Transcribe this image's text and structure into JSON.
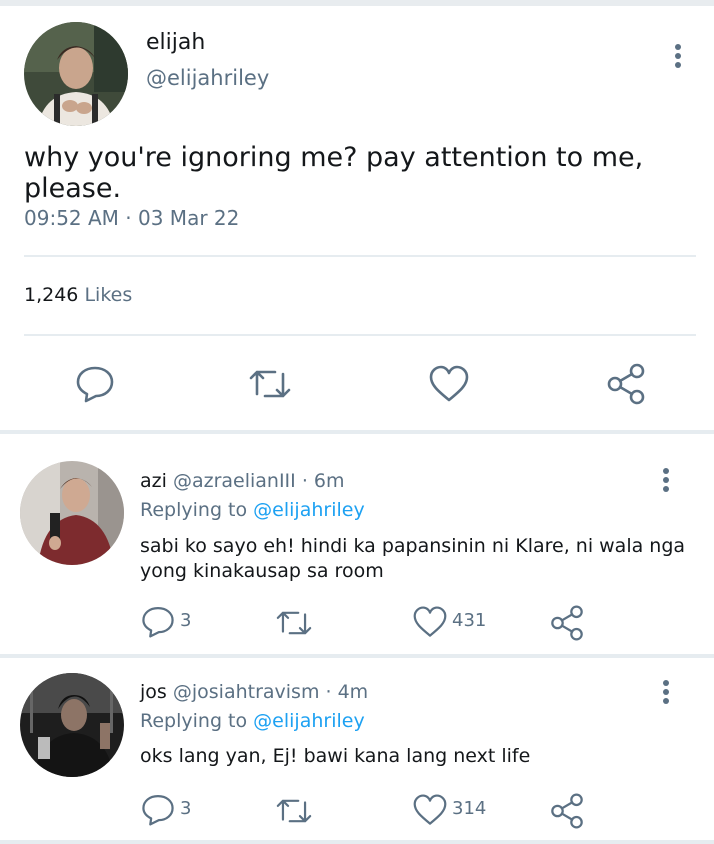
{
  "main_tweet": {
    "display_name": "elijah",
    "handle": "@elijahriley",
    "text": "why you're ignoring me? pay attention to me, please.",
    "timestamp": "09:52 AM · 03 Mar 22",
    "likes_count": "1,246",
    "likes_label": "Likes"
  },
  "replies": [
    {
      "display_name": "azi",
      "handle": "@azraelianIII",
      "time": "· 6m",
      "replying_label": "Replying to",
      "replying_handle": "@elijahriley",
      "text_line1": "sabi ko sayo eh! hindi ka papansinin ni Klare, ni wala nga",
      "text_line2": "yong kinakausap sa room",
      "reply_count": "3",
      "like_count": "431"
    },
    {
      "display_name": "jos",
      "handle": "@josiahtravism",
      "time": "· 4m",
      "replying_label": "Replying to",
      "replying_handle": "@elijahriley",
      "text_line1": "oks lang yan, Ej! bawi kana lang next life",
      "reply_count": "3",
      "like_count": "314"
    }
  ],
  "icons": {
    "reply": "reply-icon",
    "retweet": "retweet-icon",
    "like": "heart-icon",
    "share": "share-icon",
    "more": "more-vertical-icon"
  },
  "colors": {
    "link": "#1da1f2",
    "icon": "#5b7083",
    "divider": "#e6ecf0"
  }
}
